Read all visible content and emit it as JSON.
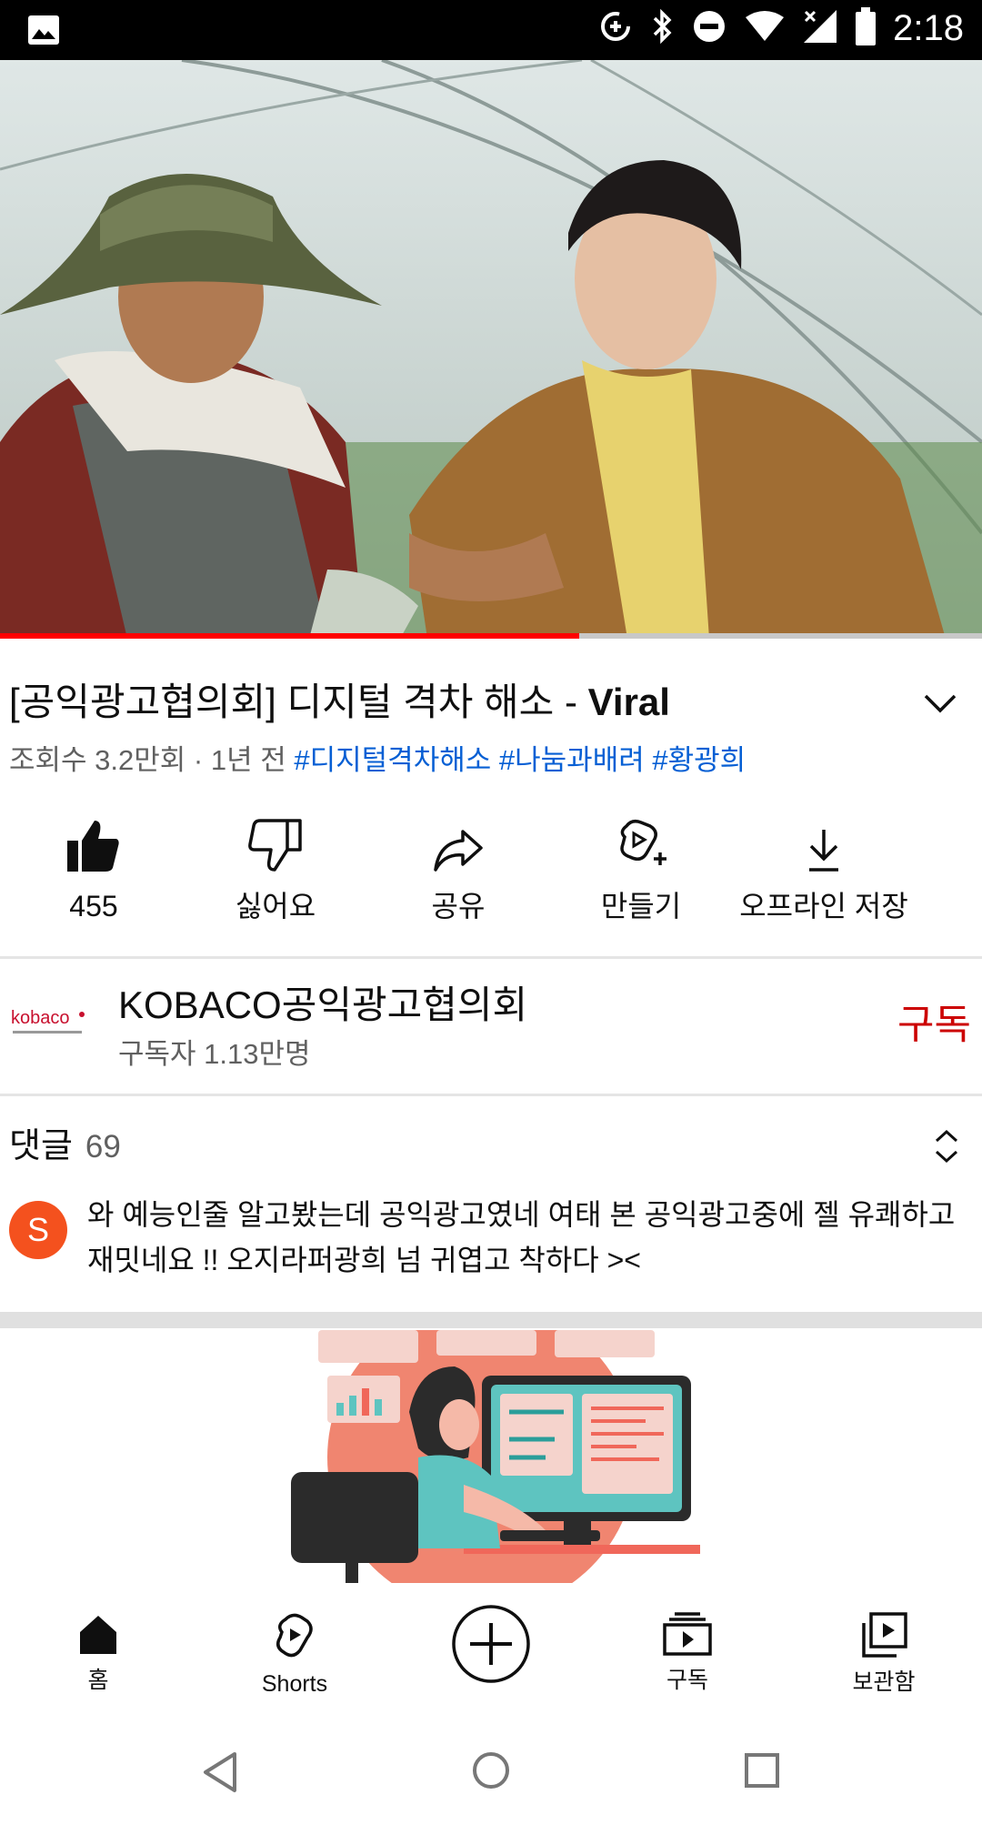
{
  "status_bar": {
    "time": "2:18",
    "icons": [
      "image-icon",
      "data-saver-icon",
      "bluetooth-icon",
      "dnd-icon",
      "wifi-icon",
      "signal-icon",
      "battery-icon"
    ]
  },
  "video": {
    "progress": 0.59,
    "progress_color": "#ff0000"
  },
  "title": {
    "korean": "[공익광고협의회] 디지털 격차 해소 - ",
    "bold": "Viral"
  },
  "meta": {
    "views_date": "조회수 3.2만회 · 1년 전",
    "hashtags": [
      "#디지털격차해소",
      "#나눔과배려",
      "#황광희"
    ]
  },
  "actions": [
    {
      "label": "455",
      "icon": "like-icon"
    },
    {
      "label": "싫어요",
      "icon": "dislike-icon"
    },
    {
      "label": "공유",
      "icon": "share-icon"
    },
    {
      "label": "만들기",
      "icon": "create-icon"
    },
    {
      "label": "오프라인 저장",
      "icon": "download-icon"
    }
  ],
  "channel": {
    "logo_text": "kobaco",
    "name": "KOBACO공익광고협의회",
    "subscribers": "구독자 1.13만명",
    "subscribe_label": "구독",
    "subscribe_color": "#cc0000"
  },
  "comments": {
    "header": "댓글",
    "count": "69",
    "first": {
      "avatar_letter": "S",
      "text": "와 예능인줄 알고봤는데 공익광고였네 여태 본 공익광고중에 젤 유쾌하고 재밋네요 !! 오지라퍼광희 넘 귀엽고 착하다 ><"
    }
  },
  "bottom_nav": [
    {
      "label": "홈",
      "icon": "home-icon"
    },
    {
      "label": "Shorts",
      "icon": "shorts-icon"
    },
    {
      "label": "",
      "icon": "create-plus-icon"
    },
    {
      "label": "구독",
      "icon": "subscriptions-icon"
    },
    {
      "label": "보관함",
      "icon": "library-icon"
    }
  ],
  "colors": {
    "accent": "#065fd4",
    "secondary_text": "#606060"
  }
}
